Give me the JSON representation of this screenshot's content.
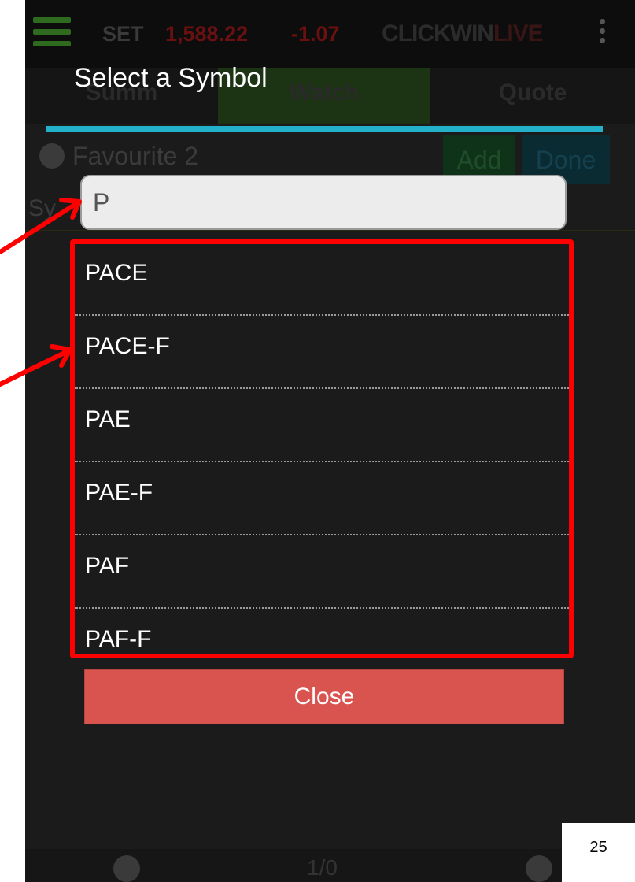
{
  "app_bar": {
    "index_name": "SET",
    "index_value": "1,588.22",
    "index_change": "-1.07",
    "logo_left": "CLICK",
    "logo_mid": "WIN",
    "logo_right": "LIVE"
  },
  "tabs": [
    {
      "label": "Summ"
    },
    {
      "label": "Watch"
    },
    {
      "label": "Quote"
    }
  ],
  "watchlist": {
    "title": "Favourite 2",
    "add_label": "Add",
    "done_label": "Done",
    "symbol_column_stub": "Sy"
  },
  "pager": {
    "text": "1/0"
  },
  "dialog": {
    "title": "Select a Symbol",
    "search_value": "P",
    "results": [
      "PACE",
      "PACE-F",
      "PAE",
      "PAE-F",
      "PAF",
      "PAF-F"
    ],
    "close_label": "Close"
  },
  "slide_number": "25",
  "colors": {
    "accent_rule": "#22b1c8",
    "close_button": "#d9534f",
    "annotation_red": "#ff0000"
  },
  "icons": [
    "menu-icon",
    "more-vert-icon",
    "chevron-down-circle-icon",
    "chevron-left-circle-icon",
    "chevron-right-circle-icon"
  ]
}
